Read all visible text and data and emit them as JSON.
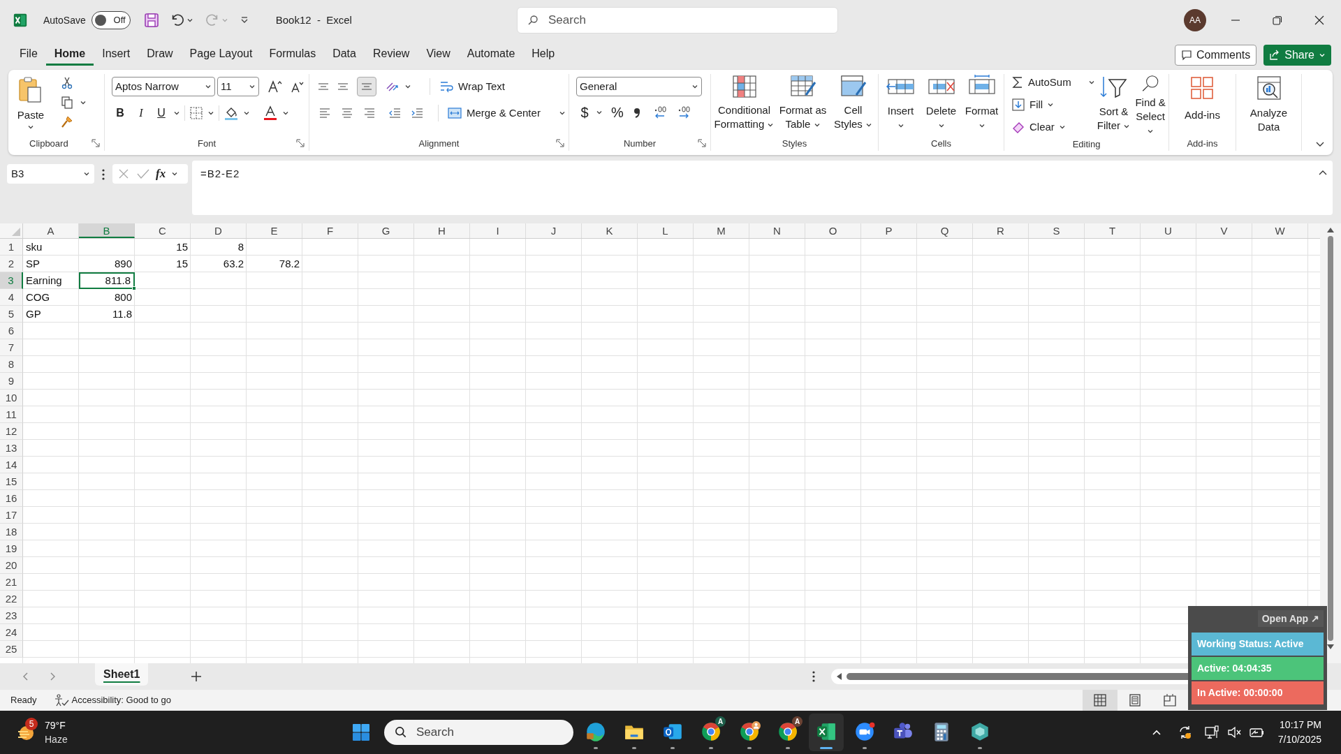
{
  "window": {
    "title": "Book12  -  Excel",
    "search_placeholder": "Search",
    "avatar": "AA"
  },
  "autosave": {
    "label": "AutoSave",
    "on": false,
    "state_text": "Off"
  },
  "menu_tabs": [
    {
      "label": "File",
      "selected": false
    },
    {
      "label": "Home",
      "selected": true
    },
    {
      "label": "Insert",
      "selected": false
    },
    {
      "label": "Draw",
      "selected": false
    },
    {
      "label": "Page Layout",
      "selected": false
    },
    {
      "label": "Formulas",
      "selected": false
    },
    {
      "label": "Data",
      "selected": false
    },
    {
      "label": "Review",
      "selected": false
    },
    {
      "label": "View",
      "selected": false
    },
    {
      "label": "Automate",
      "selected": false
    },
    {
      "label": "Help",
      "selected": false
    }
  ],
  "comments_button": "Comments",
  "share_button": "Share",
  "ribbon": {
    "clipboard": {
      "label": "Clipboard",
      "paste": "Paste"
    },
    "font": {
      "label": "Font",
      "font_name": "Aptos Narrow",
      "font_size": "11",
      "bold": "B",
      "italic": "I",
      "underline": "U"
    },
    "alignment": {
      "label": "Alignment",
      "wrap_text": "Wrap Text",
      "merge_center": "Merge & Center"
    },
    "number": {
      "label": "Number",
      "format": "General",
      "currency": "$",
      "percent": "%"
    },
    "styles": {
      "label": "Styles",
      "buttons": [
        "Conditional Formatting",
        "Format as Table",
        "Cell Styles"
      ]
    },
    "cells": {
      "label": "Cells",
      "buttons": [
        "Insert",
        "Delete",
        "Format"
      ]
    },
    "editing": {
      "label": "Editing",
      "autosum": "AutoSum",
      "fill": "Fill",
      "clear": "Clear",
      "sort_filter": "Sort & Filter",
      "find_select": "Find & Select"
    },
    "addins": {
      "label": "Add-ins",
      "button": "Add-ins"
    },
    "analyze": {
      "button": "Analyze Data"
    }
  },
  "formula_bar": {
    "name_box": "B3",
    "function_label": "fx",
    "formula": "=B2-E2"
  },
  "sheet": {
    "columns": [
      {
        "label": "A",
        "selected": false
      },
      {
        "label": "B",
        "selected": true
      },
      {
        "label": "C",
        "selected": false
      },
      {
        "label": "D",
        "selected": false
      },
      {
        "label": "E",
        "selected": false
      },
      {
        "label": "F",
        "selected": false
      },
      {
        "label": "G",
        "selected": false
      },
      {
        "label": "H",
        "selected": false
      },
      {
        "label": "I",
        "selected": false
      },
      {
        "label": "J",
        "selected": false
      },
      {
        "label": "K",
        "selected": false
      },
      {
        "label": "L",
        "selected": false
      },
      {
        "label": "M",
        "selected": false
      },
      {
        "label": "N",
        "selected": false
      },
      {
        "label": "O",
        "selected": false
      },
      {
        "label": "P",
        "selected": false
      },
      {
        "label": "Q",
        "selected": false
      },
      {
        "label": "R",
        "selected": false
      },
      {
        "label": "S",
        "selected": false
      },
      {
        "label": "T",
        "selected": false
      },
      {
        "label": "U",
        "selected": false
      },
      {
        "label": "V",
        "selected": false
      },
      {
        "label": "W",
        "selected": false
      }
    ],
    "rows": [
      {
        "label": "1",
        "selected": false,
        "cells": {
          "A": {
            "value": "sku",
            "kind": "text",
            "selected": false
          },
          "C": {
            "value": "15",
            "kind": "number",
            "selected": false
          },
          "D": {
            "value": "8",
            "kind": "number",
            "selected": false
          }
        }
      },
      {
        "label": "2",
        "selected": false,
        "cells": {
          "A": {
            "value": "SP",
            "kind": "text",
            "selected": false
          },
          "B": {
            "value": "890",
            "kind": "number",
            "selected": false
          },
          "C": {
            "value": "15",
            "kind": "number",
            "selected": false
          },
          "D": {
            "value": "63.2",
            "kind": "number",
            "selected": false
          },
          "E": {
            "value": "78.2",
            "kind": "number",
            "selected": false
          }
        }
      },
      {
        "label": "3",
        "selected": true,
        "cells": {
          "A": {
            "value": "Earning",
            "kind": "text",
            "selected": false
          },
          "B": {
            "value": "811.8",
            "kind": "number",
            "selected": true
          }
        }
      },
      {
        "label": "4",
        "selected": false,
        "cells": {
          "A": {
            "value": "COG",
            "kind": "text",
            "selected": false
          },
          "B": {
            "value": "800",
            "kind": "number",
            "selected": false
          }
        }
      },
      {
        "label": "5",
        "selected": false,
        "cells": {
          "A": {
            "value": "GP",
            "kind": "text",
            "selected": false
          },
          "B": {
            "value": "11.8",
            "kind": "number",
            "selected": false
          }
        }
      },
      {
        "label": "6",
        "selected": false
      },
      {
        "label": "7",
        "selected": false
      },
      {
        "label": "8",
        "selected": false
      },
      {
        "label": "9",
        "selected": false
      },
      {
        "label": "10",
        "selected": false
      },
      {
        "label": "11",
        "selected": false
      },
      {
        "label": "12",
        "selected": false
      },
      {
        "label": "13",
        "selected": false
      },
      {
        "label": "14",
        "selected": false
      },
      {
        "label": "15",
        "selected": false
      },
      {
        "label": "16",
        "selected": false
      },
      {
        "label": "17",
        "selected": false
      },
      {
        "label": "18",
        "selected": false
      },
      {
        "label": "19",
        "selected": false
      },
      {
        "label": "20",
        "selected": false
      },
      {
        "label": "21",
        "selected": false
      },
      {
        "label": "22",
        "selected": false
      },
      {
        "label": "23",
        "selected": false
      },
      {
        "label": "24",
        "selected": false
      },
      {
        "label": "25",
        "selected": false
      }
    ]
  },
  "sheet_tabs": [
    {
      "label": "Sheet1",
      "selected": true
    }
  ],
  "status_bar": {
    "ready": "Ready",
    "accessibility": "Accessibility: Good to go",
    "views": [
      {
        "selected": true
      },
      {
        "selected": false
      },
      {
        "selected": false
      }
    ]
  },
  "tracker": {
    "open_app": "Open App ↗",
    "rows": [
      {
        "label": "Working Status: Active",
        "color": "#5bb8d4"
      },
      {
        "label": "Active: 04:04:35",
        "color": "#4cc47a"
      },
      {
        "label": "In Active: 00:00:00",
        "color": "#ec6a5e"
      }
    ]
  },
  "taskbar": {
    "weather": {
      "temperature": "79°F",
      "condition": "Haze",
      "badge": "5"
    },
    "search_placeholder": "Search",
    "apps": [
      {
        "selected": false,
        "running": true
      },
      {
        "selected": false,
        "running": true
      },
      {
        "selected": false,
        "running": true
      },
      {
        "selected": false,
        "running": true,
        "badge": "A"
      },
      {
        "selected": false,
        "running": true
      },
      {
        "selected": false,
        "running": true,
        "badge": "A"
      },
      {
        "selected": true,
        "running": true
      },
      {
        "selected": false,
        "running": true
      },
      {
        "selected": false,
        "running": false
      },
      {
        "selected": false,
        "running": false
      },
      {
        "selected": false,
        "running": true
      }
    ],
    "time": "10:17 PM",
    "date": "7/10/2025"
  }
}
